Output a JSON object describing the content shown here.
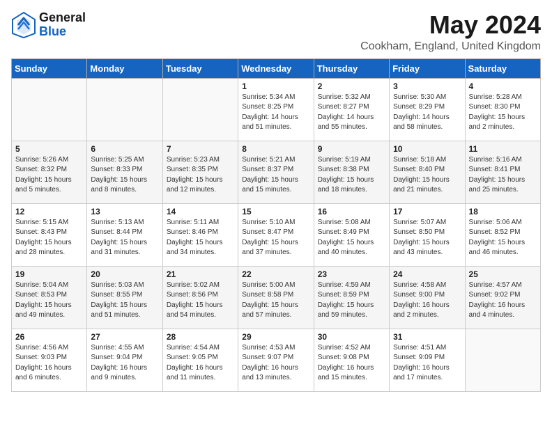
{
  "header": {
    "logo_general": "General",
    "logo_blue": "Blue",
    "month": "May 2024",
    "location": "Cookham, England, United Kingdom"
  },
  "weekdays": [
    "Sunday",
    "Monday",
    "Tuesday",
    "Wednesday",
    "Thursday",
    "Friday",
    "Saturday"
  ],
  "weeks": [
    [
      {
        "day": "",
        "content": ""
      },
      {
        "day": "",
        "content": ""
      },
      {
        "day": "",
        "content": ""
      },
      {
        "day": "1",
        "content": "Sunrise: 5:34 AM\nSunset: 8:25 PM\nDaylight: 14 hours\nand 51 minutes."
      },
      {
        "day": "2",
        "content": "Sunrise: 5:32 AM\nSunset: 8:27 PM\nDaylight: 14 hours\nand 55 minutes."
      },
      {
        "day": "3",
        "content": "Sunrise: 5:30 AM\nSunset: 8:29 PM\nDaylight: 14 hours\nand 58 minutes."
      },
      {
        "day": "4",
        "content": "Sunrise: 5:28 AM\nSunset: 8:30 PM\nDaylight: 15 hours\nand 2 minutes."
      }
    ],
    [
      {
        "day": "5",
        "content": "Sunrise: 5:26 AM\nSunset: 8:32 PM\nDaylight: 15 hours\nand 5 minutes."
      },
      {
        "day": "6",
        "content": "Sunrise: 5:25 AM\nSunset: 8:33 PM\nDaylight: 15 hours\nand 8 minutes."
      },
      {
        "day": "7",
        "content": "Sunrise: 5:23 AM\nSunset: 8:35 PM\nDaylight: 15 hours\nand 12 minutes."
      },
      {
        "day": "8",
        "content": "Sunrise: 5:21 AM\nSunset: 8:37 PM\nDaylight: 15 hours\nand 15 minutes."
      },
      {
        "day": "9",
        "content": "Sunrise: 5:19 AM\nSunset: 8:38 PM\nDaylight: 15 hours\nand 18 minutes."
      },
      {
        "day": "10",
        "content": "Sunrise: 5:18 AM\nSunset: 8:40 PM\nDaylight: 15 hours\nand 21 minutes."
      },
      {
        "day": "11",
        "content": "Sunrise: 5:16 AM\nSunset: 8:41 PM\nDaylight: 15 hours\nand 25 minutes."
      }
    ],
    [
      {
        "day": "12",
        "content": "Sunrise: 5:15 AM\nSunset: 8:43 PM\nDaylight: 15 hours\nand 28 minutes."
      },
      {
        "day": "13",
        "content": "Sunrise: 5:13 AM\nSunset: 8:44 PM\nDaylight: 15 hours\nand 31 minutes."
      },
      {
        "day": "14",
        "content": "Sunrise: 5:11 AM\nSunset: 8:46 PM\nDaylight: 15 hours\nand 34 minutes."
      },
      {
        "day": "15",
        "content": "Sunrise: 5:10 AM\nSunset: 8:47 PM\nDaylight: 15 hours\nand 37 minutes."
      },
      {
        "day": "16",
        "content": "Sunrise: 5:08 AM\nSunset: 8:49 PM\nDaylight: 15 hours\nand 40 minutes."
      },
      {
        "day": "17",
        "content": "Sunrise: 5:07 AM\nSunset: 8:50 PM\nDaylight: 15 hours\nand 43 minutes."
      },
      {
        "day": "18",
        "content": "Sunrise: 5:06 AM\nSunset: 8:52 PM\nDaylight: 15 hours\nand 46 minutes."
      }
    ],
    [
      {
        "day": "19",
        "content": "Sunrise: 5:04 AM\nSunset: 8:53 PM\nDaylight: 15 hours\nand 49 minutes."
      },
      {
        "day": "20",
        "content": "Sunrise: 5:03 AM\nSunset: 8:55 PM\nDaylight: 15 hours\nand 51 minutes."
      },
      {
        "day": "21",
        "content": "Sunrise: 5:02 AM\nSunset: 8:56 PM\nDaylight: 15 hours\nand 54 minutes."
      },
      {
        "day": "22",
        "content": "Sunrise: 5:00 AM\nSunset: 8:58 PM\nDaylight: 15 hours\nand 57 minutes."
      },
      {
        "day": "23",
        "content": "Sunrise: 4:59 AM\nSunset: 8:59 PM\nDaylight: 15 hours\nand 59 minutes."
      },
      {
        "day": "24",
        "content": "Sunrise: 4:58 AM\nSunset: 9:00 PM\nDaylight: 16 hours\nand 2 minutes."
      },
      {
        "day": "25",
        "content": "Sunrise: 4:57 AM\nSunset: 9:02 PM\nDaylight: 16 hours\nand 4 minutes."
      }
    ],
    [
      {
        "day": "26",
        "content": "Sunrise: 4:56 AM\nSunset: 9:03 PM\nDaylight: 16 hours\nand 6 minutes."
      },
      {
        "day": "27",
        "content": "Sunrise: 4:55 AM\nSunset: 9:04 PM\nDaylight: 16 hours\nand 9 minutes."
      },
      {
        "day": "28",
        "content": "Sunrise: 4:54 AM\nSunset: 9:05 PM\nDaylight: 16 hours\nand 11 minutes."
      },
      {
        "day": "29",
        "content": "Sunrise: 4:53 AM\nSunset: 9:07 PM\nDaylight: 16 hours\nand 13 minutes."
      },
      {
        "day": "30",
        "content": "Sunrise: 4:52 AM\nSunset: 9:08 PM\nDaylight: 16 hours\nand 15 minutes."
      },
      {
        "day": "31",
        "content": "Sunrise: 4:51 AM\nSunset: 9:09 PM\nDaylight: 16 hours\nand 17 minutes."
      },
      {
        "day": "",
        "content": ""
      }
    ]
  ]
}
